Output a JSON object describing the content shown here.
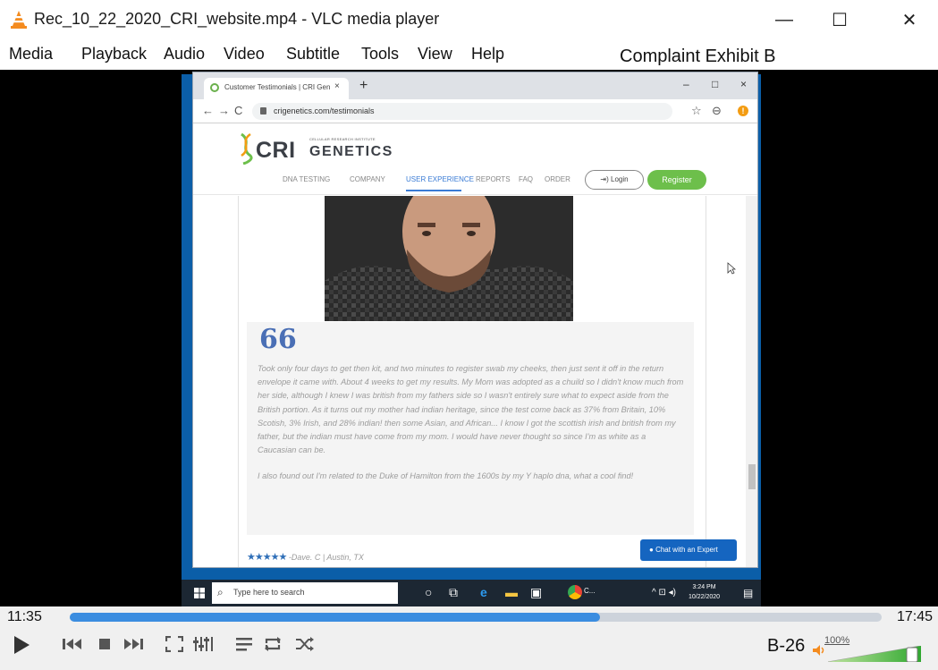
{
  "window": {
    "title": "Rec_10_22_2020_CRI_website.mp4 - VLC media player",
    "minimize_glyph": "—",
    "maximize_glyph": "☐",
    "close_glyph": "✕"
  },
  "menu": [
    "Media",
    "Playback",
    "Audio",
    "Video",
    "Subtitle",
    "Tools",
    "View",
    "Help"
  ],
  "overlay_label": "Complaint Exhibit B",
  "browser": {
    "tab_title": "Customer Testimonials | CRI Gen",
    "tab_close": "×",
    "new_tab": "+",
    "window_buttons": [
      "–",
      "□",
      "×"
    ],
    "nav": {
      "back": "←",
      "forward": "→",
      "reload": "C"
    },
    "url": "crigenetics.com/testimonials",
    "star_icon": "☆",
    "profile_icon": "⊖",
    "alert_icon": "!"
  },
  "site": {
    "logo_cri": "CRI",
    "logo_small": "CELLULAR RESEARCH INSTITUTE",
    "logo_genetics": "GENETICS",
    "nav": [
      "DNA TESTING",
      "COMPANY",
      "USER EXPERIENCE",
      "REPORTS",
      "FAQ",
      "ORDER"
    ],
    "active_nav": "USER EXPERIENCE",
    "login_label": "⇥) Login",
    "register_label": "Register"
  },
  "testimonial": {
    "quote_mark": "66",
    "paragraphs": [
      "Took only four days to get then kit, and two minutes to register swab my cheeks, then just sent it off in the return envelope it came with. About 4 weeks to get my results. My Mom was adopted as a chuild so I didn't know much from her side, although I knew I was british from my fathers side so I wasn't entirely sure what to expect aside from the British portion. As it turns out my mother had indian heritage, since the test come back as 37% from Britain, 10% Scotish, 3% Irish, and 28% indian! then some Asian, and African... I know I got the scottish irish and british from my father, but the indian must have come from my mom. I would have never thought so since I'm as white as a Caucasian can be.",
      "I also found out I'm related to the Duke of Hamilton from the 1600s by my Y haplo dna, what a cool find!"
    ],
    "stars": "★★★★★",
    "reviewer": "-Dave. C | Austin, TX"
  },
  "chat_button": "Chat with an Expert",
  "taskbar": {
    "search_placeholder": "Type here to search",
    "chrome_label": "C...",
    "clock_time": "3:24 PM",
    "clock_date": "10/22/2020"
  },
  "player": {
    "elapsed": "11:35",
    "total": "17:45",
    "progress_fraction": 0.653,
    "exhibit_page": "B-26",
    "volume_label": "100%",
    "volume_fraction": 1.0,
    "accent_color": "#3b8de0"
  }
}
